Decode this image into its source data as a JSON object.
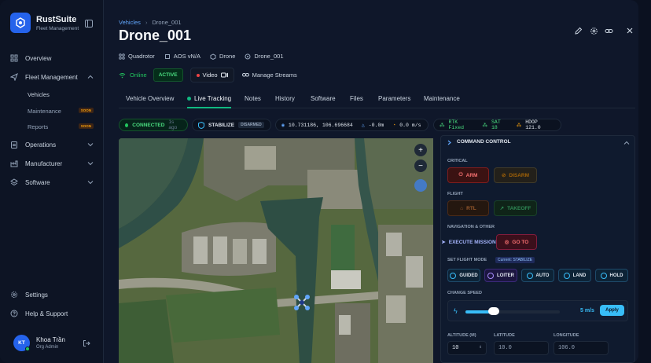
{
  "app": {
    "name": "RustSuite",
    "subtitle": "Fleet Management"
  },
  "sidebar": {
    "items": [
      {
        "label": "Overview"
      },
      {
        "label": "Fleet Management"
      },
      {
        "label": "Operations"
      },
      {
        "label": "Manufacturer"
      },
      {
        "label": "Software"
      }
    ],
    "fleet_sub": [
      {
        "label": "Vehicles"
      },
      {
        "label": "Maintenance",
        "badge": "SOON"
      },
      {
        "label": "Reports",
        "badge": "SOON"
      }
    ],
    "bottom": [
      {
        "label": "Settings"
      },
      {
        "label": "Help & Support"
      }
    ]
  },
  "user": {
    "initials": "KT",
    "name": "Khoa Trần",
    "role": "Org Admin"
  },
  "breadcrumb": {
    "parent": "Vehicles",
    "current": "Drone_001"
  },
  "vehicle": {
    "title": "Drone_001",
    "meta": [
      "Quadrotor",
      "AOS vN/A",
      "Drone",
      "Drone_001"
    ],
    "status": "Online",
    "state_badge": "ACTIVE",
    "video_label": "Video",
    "streams_label": "Manage Streams"
  },
  "tabs": [
    "Vehicle Overview",
    "Live Tracking",
    "Notes",
    "History",
    "Software",
    "Files",
    "Parameters",
    "Maintenance"
  ],
  "telemetry": {
    "connection": "CONNECTED",
    "conn_age": "1s ago",
    "mode": "STABILIZE",
    "armed_state": "DISARMED",
    "coords": "10.731186, 106.696684",
    "altitude": "-0.0m",
    "speed": "0.0 m/s",
    "rtk": "RTK Fixed",
    "sats": "SAT 18",
    "hdop": "HDOP 121.0"
  },
  "map": {
    "zoom_in": "+",
    "zoom_out": "−"
  },
  "command": {
    "title": "COMMAND CONTROL",
    "critical": "CRITICAL",
    "arm": "ARM",
    "disarm": "DISARM",
    "flight": "FLIGHT",
    "rtl": "RTL",
    "takeoff": "TAKEOFF",
    "nav": "NAVIGATION & OTHER",
    "execute": "EXECUTE MISSION",
    "goto": "GO TO",
    "set_mode": "SET FLIGHT MODE",
    "current_mode": "Current: STABILIZE",
    "modes": [
      "GUIDED",
      "LOITER",
      "AUTO",
      "LAND",
      "HOLD"
    ],
    "speed_label": "CHANGE SPEED",
    "speed_value": "5 m/s",
    "speed_fraction": 0.3,
    "apply": "Apply",
    "altitude_label": "ALTITUDE (M)",
    "altitude_value": "10",
    "lat_label": "LATITUDE",
    "lat_placeholder": "10.0",
    "lon_label": "LONGITUDE",
    "lon_placeholder": "106.0"
  },
  "colors": {
    "accent": "#10b981",
    "brand": "#2563eb",
    "danger": "#ef4444",
    "info": "#38bdf8"
  }
}
